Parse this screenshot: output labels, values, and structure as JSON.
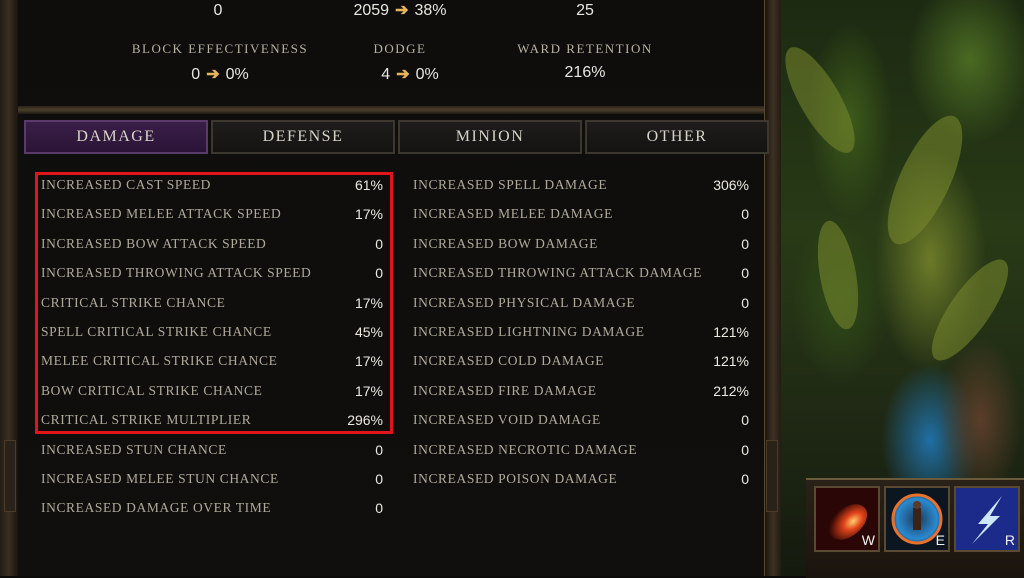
{
  "top_stats_row1": [
    {
      "value": "0"
    },
    {
      "value": "2059",
      "arrow": "➔",
      "result": "38%"
    },
    {
      "value": "25"
    }
  ],
  "top_stats_row2": [
    {
      "label": "BLOCK EFFECTIVENESS",
      "value": "0",
      "arrow": "➔",
      "result": "0%"
    },
    {
      "label": "DODGE",
      "value": "4",
      "arrow": "➔",
      "result": "0%"
    },
    {
      "label": "WARD RETENTION",
      "value": "216%"
    }
  ],
  "tabs": [
    {
      "label": "DAMAGE",
      "active": true
    },
    {
      "label": "DEFENSE",
      "active": false
    },
    {
      "label": "MINION",
      "active": false
    },
    {
      "label": "OTHER",
      "active": false
    }
  ],
  "left_stats": [
    {
      "label": "INCREASED CAST SPEED",
      "value": "61%"
    },
    {
      "label": "INCREASED MELEE ATTACK SPEED",
      "value": "17%"
    },
    {
      "label": "INCREASED BOW ATTACK SPEED",
      "value": "0"
    },
    {
      "label": "INCREASED THROWING ATTACK SPEED",
      "value": "0"
    },
    {
      "label": "CRITICAL STRIKE CHANCE",
      "value": "17%"
    },
    {
      "label": "SPELL CRITICAL STRIKE CHANCE",
      "value": "45%"
    },
    {
      "label": "MELEE CRITICAL STRIKE CHANCE",
      "value": "17%"
    },
    {
      "label": "BOW CRITICAL STRIKE CHANCE",
      "value": "17%"
    },
    {
      "label": "CRITICAL STRIKE MULTIPLIER",
      "value": "296%"
    },
    {
      "label": "INCREASED STUN CHANCE",
      "value": "0"
    },
    {
      "label": "INCREASED MELEE STUN CHANCE",
      "value": "0"
    },
    {
      "label": "INCREASED DAMAGE OVER TIME",
      "value": "0"
    }
  ],
  "right_stats": [
    {
      "label": "INCREASED SPELL DAMAGE",
      "value": "306%"
    },
    {
      "label": "INCREASED MELEE DAMAGE",
      "value": "0"
    },
    {
      "label": "INCREASED BOW DAMAGE",
      "value": "0"
    },
    {
      "label": "INCREASED THROWING ATTACK DAMAGE",
      "value": "0"
    },
    {
      "label": "INCREASED PHYSICAL DAMAGE",
      "value": "0"
    },
    {
      "label": "INCREASED LIGHTNING DAMAGE",
      "value": "121%"
    },
    {
      "label": "INCREASED COLD DAMAGE",
      "value": "121%"
    },
    {
      "label": "INCREASED FIRE DAMAGE",
      "value": "212%"
    },
    {
      "label": "INCREASED VOID DAMAGE",
      "value": "0"
    },
    {
      "label": "INCREASED NECROTIC DAMAGE",
      "value": "0"
    },
    {
      "label": "INCREASED POISON DAMAGE",
      "value": "0"
    }
  ],
  "skills": [
    {
      "key": "W",
      "icon": "fire-meteor-icon"
    },
    {
      "key": "E",
      "icon": "arcane-figure-icon"
    },
    {
      "key": "R",
      "icon": "lightning-bolt-icon"
    }
  ],
  "colors": {
    "highlight": "#e0141a",
    "active_tab": "#3a1f48",
    "arrow": "#e9b55a"
  }
}
